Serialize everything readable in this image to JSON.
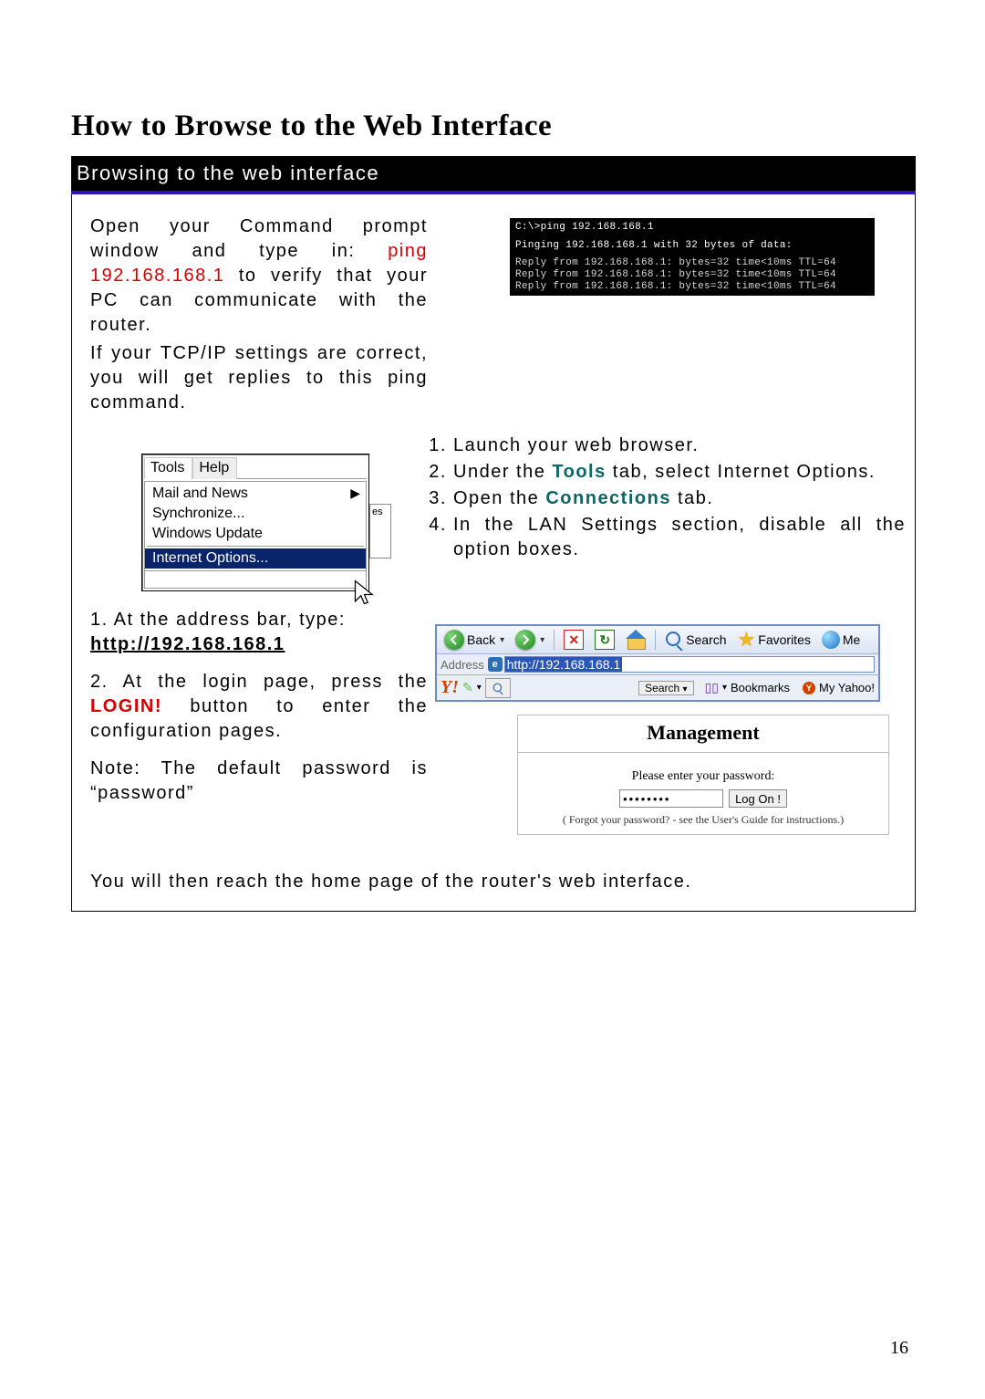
{
  "page_number": "16",
  "title": "How to Browse to the Web Interface",
  "banner": "Browsing to the web interface",
  "intro": {
    "p1_a": "Open your Command prompt window and type in: ",
    "ping_cmd": "ping 192.168.168.1",
    "p1_b": " to verify that your PC can communicate with the router.",
    "p2": "If your TCP/IP settings are correct, you will get replies to this ping command."
  },
  "ping_output": {
    "l1": "C:\\>ping 192.168.168.1",
    "l2": "Pinging 192.168.168.1 with 32 bytes of data:",
    "l3": "Reply from 192.168.168.1: bytes=32 time<10ms TTL=64",
    "l4": "Reply from 192.168.168.1: bytes=32 time<10ms TTL=64",
    "l5": "Reply from 192.168.168.1: bytes=32 time<10ms TTL=64"
  },
  "tools_menu": {
    "tab_tools": "Tools",
    "tab_help": "Help",
    "item_mailnews": "Mail and News",
    "item_sync": "Synchronize...",
    "item_winupd": "Windows Update",
    "item_inetopt": "Internet Options...",
    "side_text": "es"
  },
  "steps_right": {
    "s1": "Launch your web browser.",
    "s2_a": "Under the ",
    "s2_tools": "Tools",
    "s2_b": " tab, select Internet Options.",
    "s3_a": "Open the ",
    "s3_conn": "Connections",
    "s3_b": " tab.",
    "s4": "In the LAN Settings section, disable all the option boxes."
  },
  "steps_left": {
    "s1_a": "1. At the address bar, type: ",
    "s1_url": "http://192.168.168.1",
    "s2_a": "2. At the login page, press the ",
    "s2_login": "LOGIN!",
    "s2_b": " button to enter the configuration pages.",
    "note": "Note: The default password is “password”"
  },
  "browser_bar": {
    "back": "Back",
    "search": "Search",
    "favorites": "Favorites",
    "me": "Me",
    "addr_label": "Address",
    "addr_url": "http://192.168.168.1",
    "y_search_btn": "Search",
    "bookmarks": "Bookmarks",
    "my_yahoo": "My Yahoo!"
  },
  "mgmt": {
    "title": "Management",
    "prompt": "Please enter your password:",
    "password_mask": "••••••••",
    "logon_btn": "Log On !",
    "forgot": "( Forgot your password? - see the User's Guide for instructions.)"
  },
  "footer": "You will then reach the home page of the router's web interface."
}
